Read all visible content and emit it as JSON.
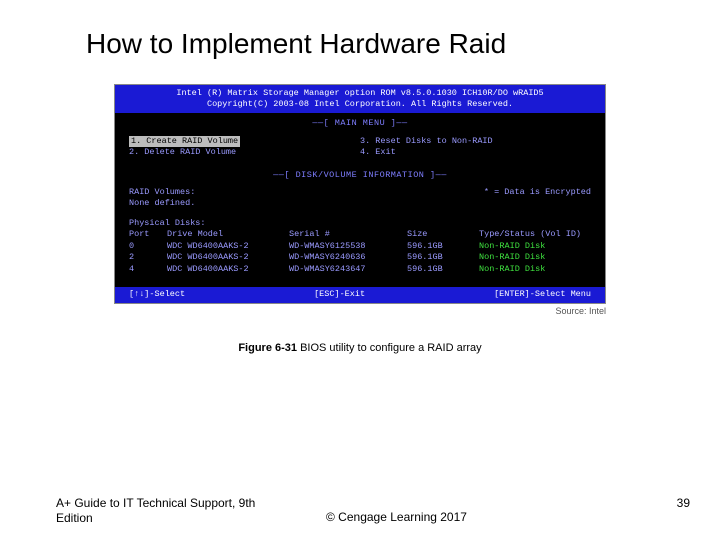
{
  "title": "How to Implement Hardware Raid",
  "bios": {
    "header_line1": "Intel (R) Matrix Storage Manager option ROM v8.5.0.1030 ICH10R/DO wRAID5",
    "header_line2": "Copyright(C) 2003-08 Intel Corporation.  All Rights Reserved.",
    "main_menu_label": "——[ MAIN MENU ]——",
    "menu": {
      "item1": "1.  Create RAID Volume",
      "item2": "2.  Delete RAID Volume",
      "item3": "3.  Reset Disks to Non-RAID",
      "item4": "4.  Exit"
    },
    "disk_label": "——[ DISK/VOLUME INFORMATION ]——",
    "raid_volumes_label": "RAID Volumes:",
    "raid_volumes_status": "None defined.",
    "encrypted_note": "* = Data is Encrypted",
    "phys_label": "Physical Disks:",
    "headers": {
      "port": "Port",
      "model": "Drive Model",
      "serial": "Serial #",
      "size": "Size",
      "type": "Type/Status (Vol ID)"
    },
    "disks": [
      {
        "port": "0",
        "model": "WDC WD6400AAKS-2",
        "serial": "WD-WMASY6125538",
        "size": "596.1GB",
        "type": "Non-RAID Disk"
      },
      {
        "port": "2",
        "model": "WDC WD6400AAKS-2",
        "serial": "WD-WMASY6240636",
        "size": "596.1GB",
        "type": "Non-RAID Disk"
      },
      {
        "port": "4",
        "model": "WDC WD6400AAKS-2",
        "serial": "WD-WMASY6243647",
        "size": "596.1GB",
        "type": "Non-RAID Disk"
      }
    ],
    "hint_select": "[↑↓]-Select",
    "hint_exit": "[ESC]-Exit",
    "hint_enter": "[ENTER]-Select Menu"
  },
  "source_credit": "Source: Intel",
  "caption_bold": "Figure 6-31",
  "caption_rest": " BIOS utility to configure a RAID array",
  "footer": {
    "left": "A+ Guide to IT Technical Support, 9th Edition",
    "center": "© Cengage Learning  2017",
    "page": "39"
  }
}
